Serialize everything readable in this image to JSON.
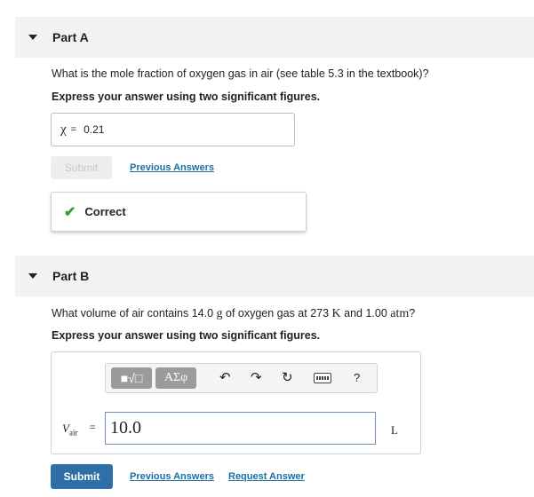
{
  "partA": {
    "title": "Part A",
    "question": "What is the mole fraction of oxygen gas in air (see table 5.3 in the textbook)?",
    "instruction": "Express your answer using two significant figures.",
    "variable": "χ",
    "equals": "=",
    "value": "0.21",
    "submit_label": "Submit",
    "previous_answers_label": "Previous Answers",
    "feedback": "Correct"
  },
  "partB": {
    "title": "Part B",
    "question_pre": "What volume of air contains 14.0 ",
    "unit_g": "g",
    "question_mid": " of oxygen gas at 273 ",
    "unit_K": "K",
    "question_mid2": " and 1.00 ",
    "unit_atm": "atm",
    "question_post": "?",
    "instruction": "Express your answer using two significant figures.",
    "toolbar": {
      "templates_label": "■√□",
      "greek_label": "ΑΣφ",
      "help_label": "?"
    },
    "variable": "V",
    "variable_sub": "air",
    "equals": "=",
    "value": "10.0",
    "unit": "L",
    "submit_label": "Submit",
    "previous_answers_label": "Previous Answers",
    "request_answer_label": "Request Answer"
  },
  "colors": {
    "submit_bg": "#2f6fa7",
    "link": "#1a6fa0",
    "correct_check": "#3b9a3b"
  }
}
